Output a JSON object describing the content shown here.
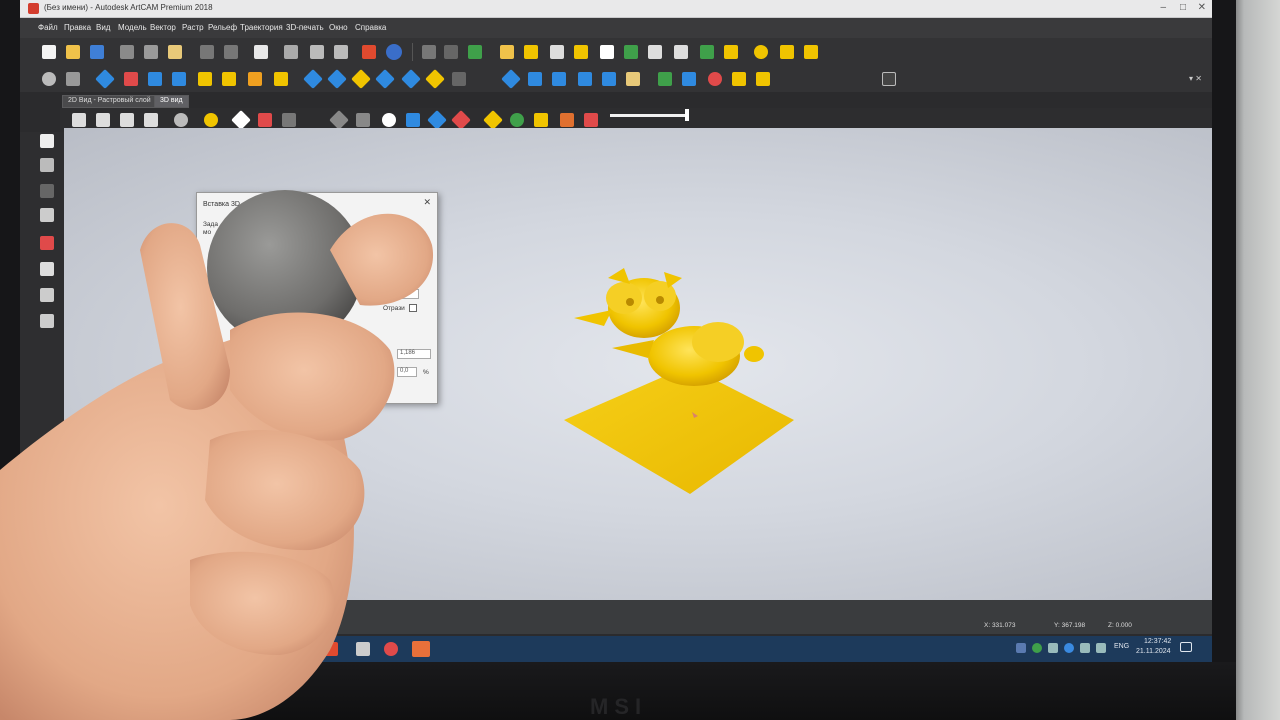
{
  "window": {
    "title": "(Без имени) - Autodesk ArtCAM Premium 2018"
  },
  "menu": {
    "items": [
      "Файл",
      "Правка",
      "Вид",
      "Модель",
      "Вектор",
      "Растр",
      "Рельеф",
      "Траектория",
      "3D-печать",
      "Окно",
      "Справка"
    ]
  },
  "view_tabs": {
    "tab_2d": "2D Вид - Растровый слой",
    "tab_3d": "3D вид"
  },
  "dialog": {
    "title": "Вставка 3D",
    "line1": "Зада",
    "line2": "мо",
    "mirror_label": "Отрази",
    "value_1": "0",
    "value_2": "1,186",
    "value_3": "0,0",
    "unit": "%"
  },
  "status": {
    "x": "X: 331.073",
    "y": "Y: 367.198",
    "z": "Z: 0.000"
  },
  "tray": {
    "lang": "ENG",
    "time": "12:37:42",
    "date": "21.11.2024"
  },
  "colors": {
    "model_gold": "#f0c400",
    "viewport_bg": "#d3d7df",
    "taskbar": "#1d3a5b",
    "ui_dark": "#333335"
  },
  "icons": {
    "toolbar": [
      "new-file-icon",
      "open-folder-icon",
      "save-icon",
      "cut-icon",
      "copy-icon",
      "paste-icon",
      "undo-icon",
      "redo-icon"
    ],
    "left": [
      "select-arrow-icon",
      "node-edit-icon",
      "transform-icon",
      "grid-icon",
      "pencil-icon",
      "paint-bucket-icon",
      "rectangle-icon",
      "polyline-icon"
    ]
  }
}
